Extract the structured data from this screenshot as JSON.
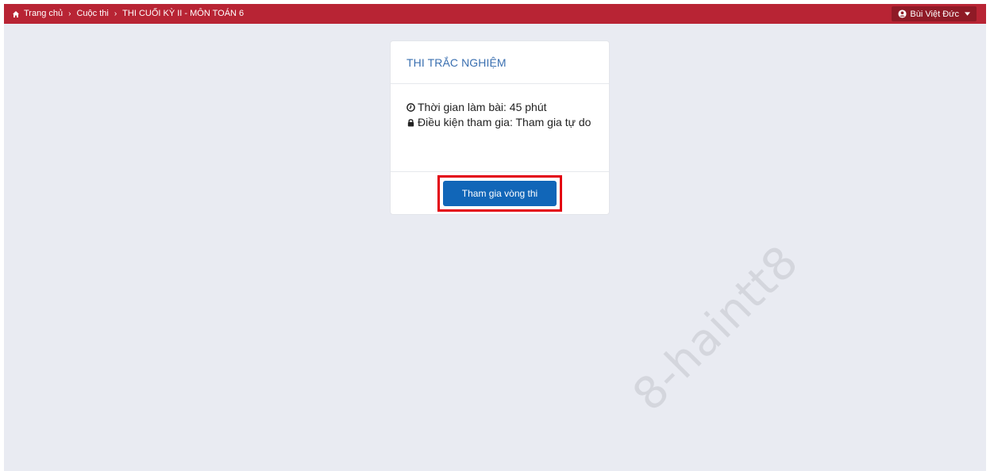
{
  "breadcrumb": {
    "home": "Trang chủ",
    "competitions": "Cuộc thi",
    "current": "THI CUỐI KỲ II - MÔN TOÁN 6",
    "separator": "›"
  },
  "user_menu": {
    "name": "Bùi Việt Đức"
  },
  "card": {
    "title": "THI TRẮC NGHIỆM",
    "duration": "Thời gian làm bài: 45 phút",
    "condition": "Điều kiện tham gia: Tham gia tự do",
    "join_label": "Tham gia vòng thi"
  },
  "watermark": "8-haintt8",
  "colors": {
    "topbar": "#b82434",
    "accent_button": "#1166b8",
    "highlight": "#e3000f",
    "background": "#e9ebf2"
  }
}
